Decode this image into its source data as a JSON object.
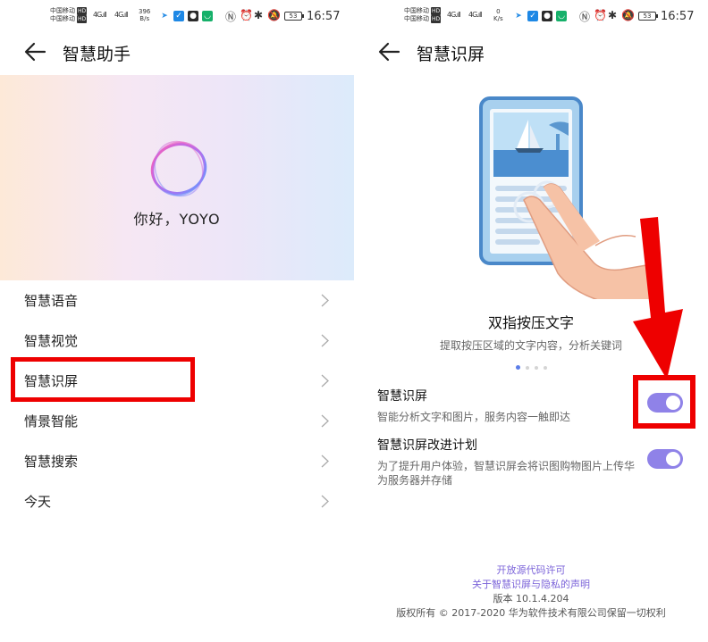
{
  "left": {
    "status": {
      "carrier1": "中国移动",
      "carrier2": "中国移动",
      "hd": "HD",
      "net1": "4G",
      "net2": "4G",
      "speed_value": "396",
      "speed_unit": "B/s",
      "battery": "53",
      "time": "16:57"
    },
    "title": "智慧助手",
    "greeting": "你好，YOYO",
    "items": [
      {
        "label": "智慧语音"
      },
      {
        "label": "智慧视觉"
      },
      {
        "label": "智慧识屏"
      },
      {
        "label": "情景智能"
      },
      {
        "label": "智慧搜索"
      },
      {
        "label": "今天"
      }
    ]
  },
  "right": {
    "status": {
      "carrier1": "中国移动",
      "carrier2": "中国移动",
      "hd": "HD",
      "net1": "4G",
      "net2": "4G",
      "speed_value": "0",
      "speed_unit": "K/s",
      "battery": "53",
      "time": "16:57"
    },
    "title": "智慧识屏",
    "feature_title": "双指按压文字",
    "feature_subtitle": "提取按压区域的文字内容，分析关键词",
    "settings": [
      {
        "title": "智慧识屏",
        "desc": "智能分析文字和图片，服务内容一触即达",
        "enabled": true
      },
      {
        "title": "智慧识屏改进计划",
        "desc": "为了提升用户体验，智慧识屏会将识图购物图片上传华为服务器并存储",
        "enabled": true
      }
    ],
    "footer": {
      "link1": "开放源代码许可",
      "link2": "关于智慧识屏与隐私的声明",
      "version": "版本 10.1.4.204",
      "copyright": "版权所有 © 2017-2020 华为软件技术有限公司保留一切权利"
    }
  },
  "colors": {
    "accent": "#8f82e8",
    "link": "#7b63d9",
    "annotation": "#ee0000"
  }
}
